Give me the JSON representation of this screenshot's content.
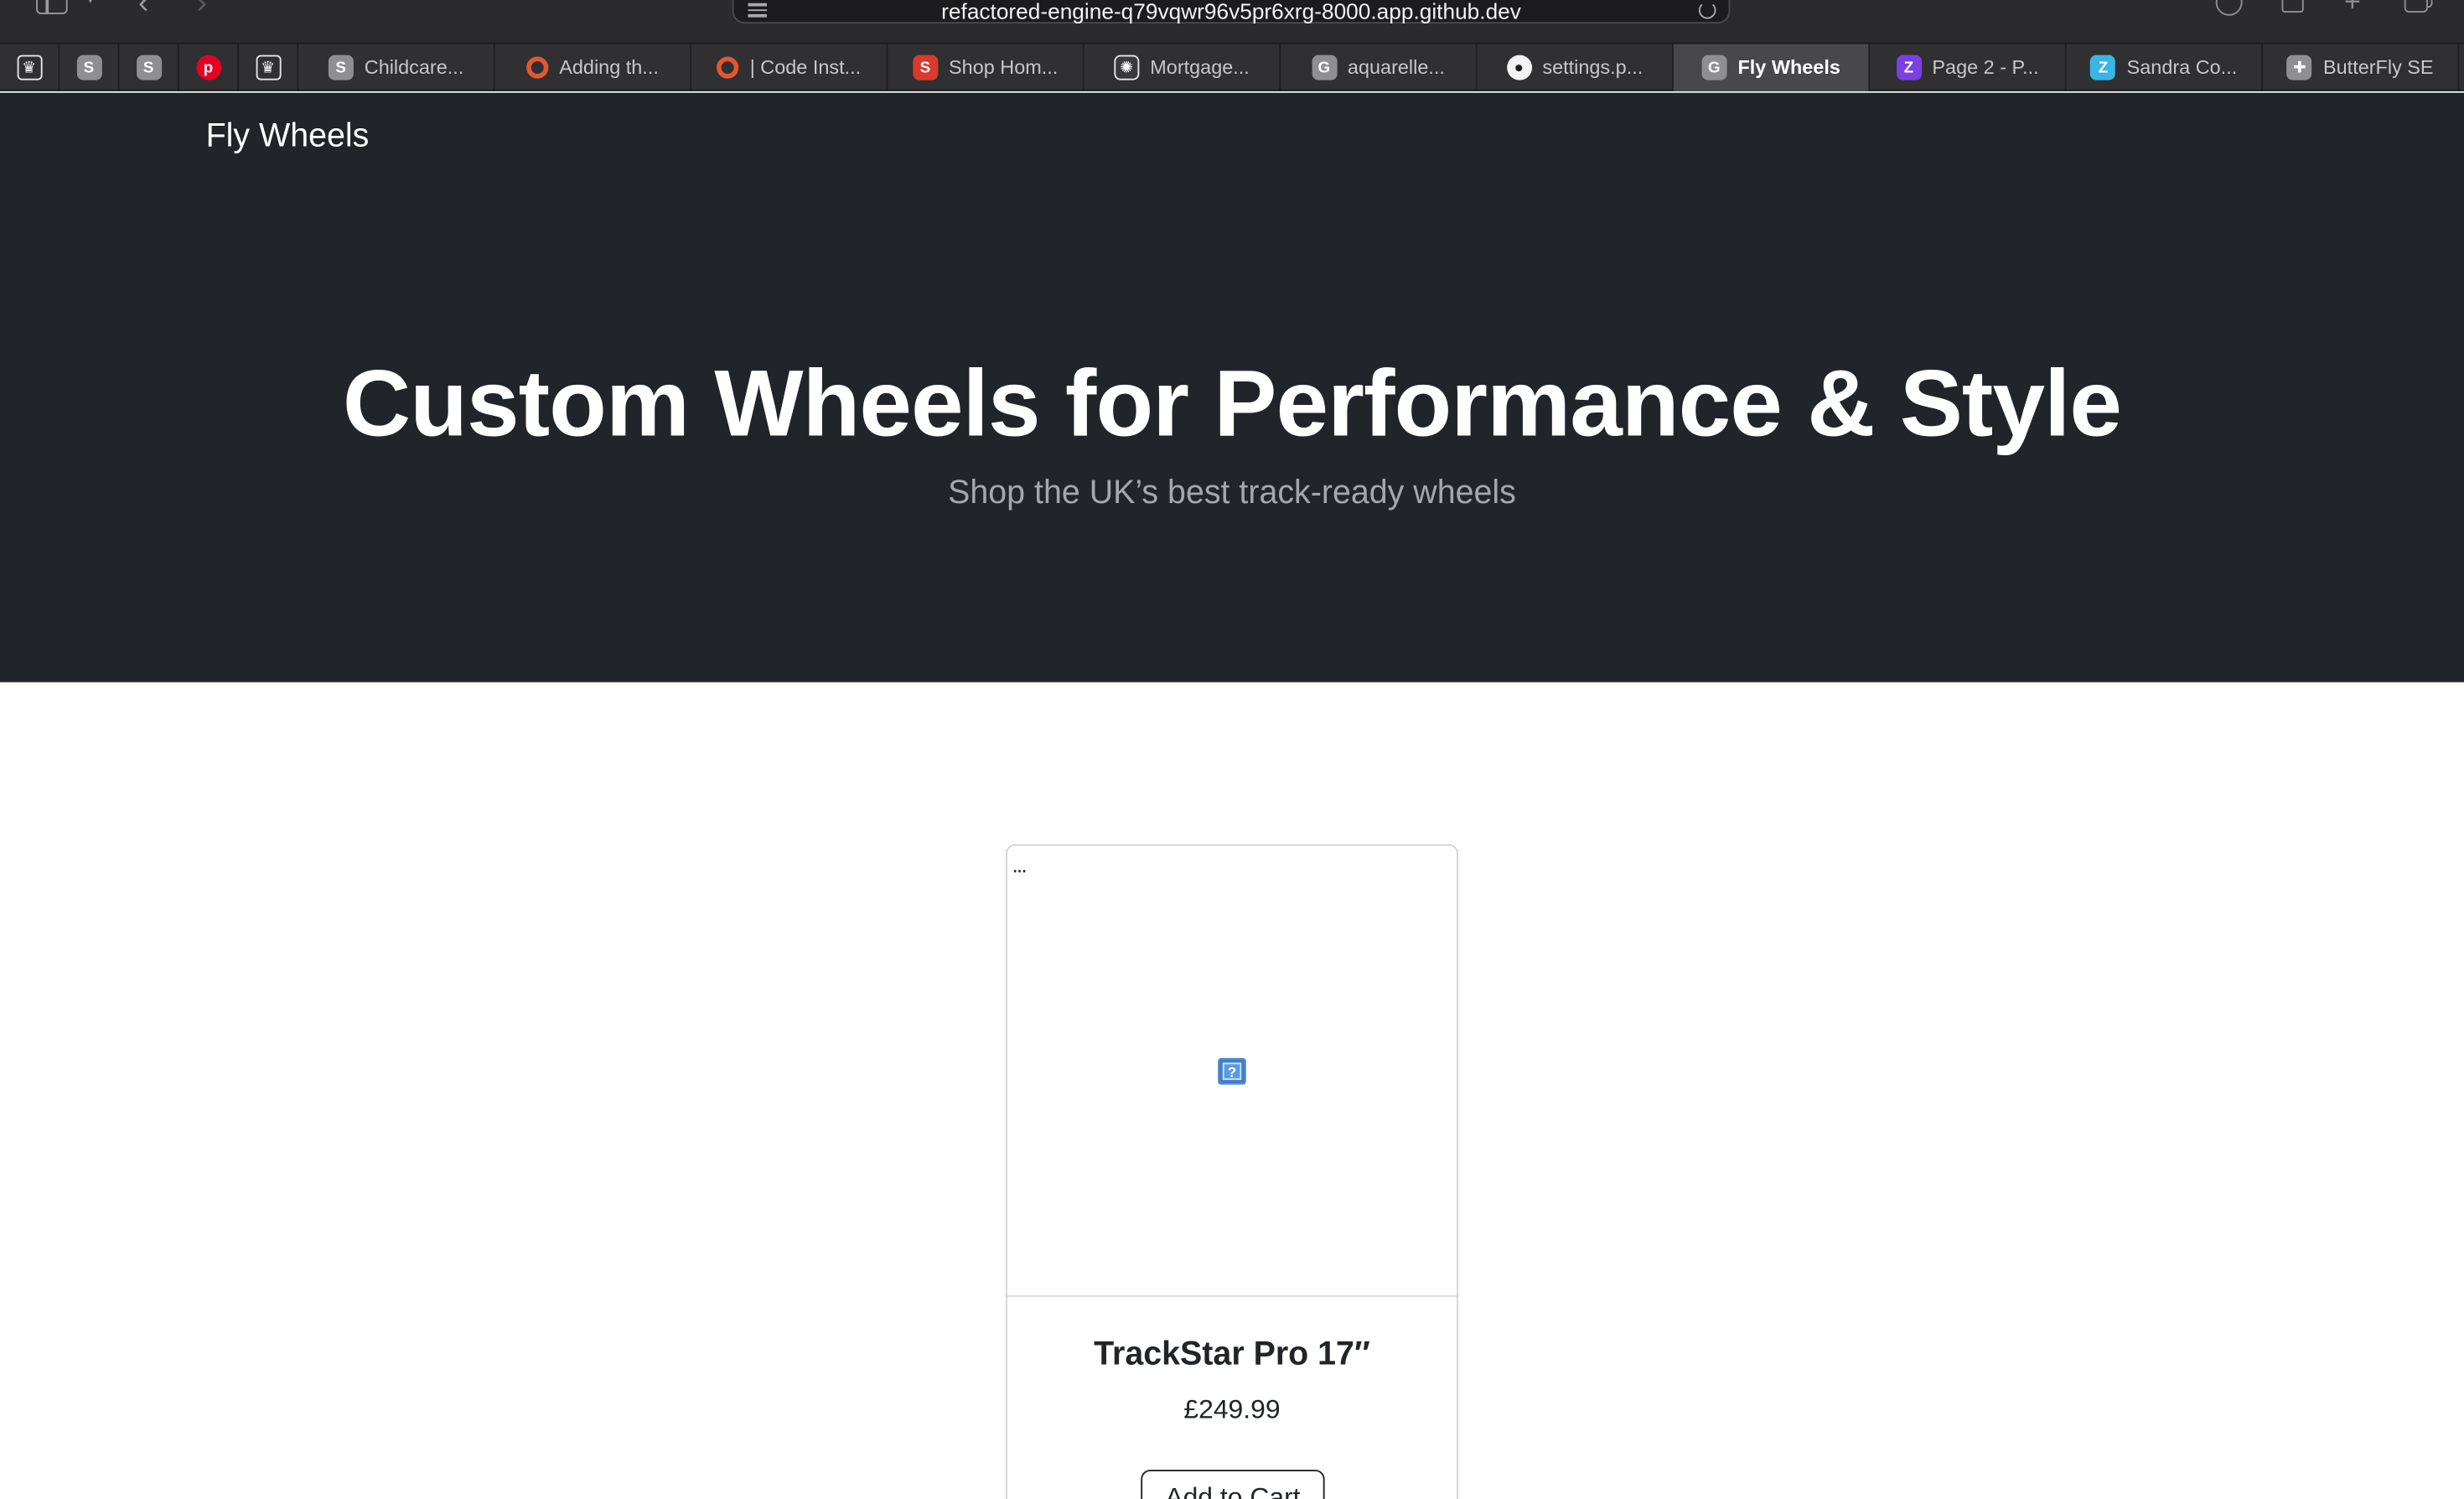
{
  "browser": {
    "url": "refactored-engine-q79vqwr96v5pr6xrg-8000.app.github.dev",
    "tabs": [
      {
        "label": "",
        "icon": "crown-icon",
        "glyph": "♛",
        "color": "#2b2b2d",
        "pinned": true
      },
      {
        "label": "",
        "icon": "s-letter-icon",
        "glyph": "S",
        "color": "#8e8e93",
        "pinned": true
      },
      {
        "label": "",
        "icon": "s-letter-icon",
        "glyph": "S",
        "color": "#8e8e93",
        "pinned": true
      },
      {
        "label": "",
        "icon": "pinterest-icon",
        "glyph": "p",
        "color": "#e60023",
        "pinned": true
      },
      {
        "label": "",
        "icon": "crown-icon",
        "glyph": "♛",
        "color": "#2b2b2d",
        "pinned": true
      },
      {
        "label": "Childcare...",
        "icon": "s-letter-icon",
        "glyph": "S",
        "color": "#8e8e93"
      },
      {
        "label": "Adding th...",
        "icon": "ring-icon",
        "glyph": "",
        "color": "#e4572e"
      },
      {
        "label": "| Code Inst...",
        "icon": "ring-icon",
        "glyph": "",
        "color": "#e4572e"
      },
      {
        "label": "Shop Hom...",
        "icon": "s-letter-icon",
        "glyph": "S",
        "color": "#d93a2b"
      },
      {
        "label": "Mortgage...",
        "icon": "openai-icon",
        "glyph": "✺",
        "color": "#3a3a3c"
      },
      {
        "label": "aquarelle...",
        "icon": "g-letter-icon",
        "glyph": "G",
        "color": "#8e8e93"
      },
      {
        "label": "settings.p...",
        "icon": "github-icon",
        "glyph": "●",
        "color": "#f2f2f2"
      },
      {
        "label": "Fly Wheels",
        "icon": "g-letter-icon",
        "glyph": "G",
        "color": "#8e8e93",
        "active": true
      },
      {
        "label": "Page 2 - P...",
        "icon": "z-letter-icon",
        "glyph": "Z",
        "color": "#7b3fe4"
      },
      {
        "label": "Sandra Co...",
        "icon": "zapier-icon",
        "glyph": "Z",
        "color": "#39b6e6"
      },
      {
        "label": "ButterFly SE",
        "icon": "butterfly-icon",
        "glyph": "✚",
        "color": "#8e8e93"
      }
    ]
  },
  "nav": {
    "brand": "Fly Wheels"
  },
  "hero": {
    "title": "Custom Wheels for Performance & Style",
    "subtitle": "Shop the UK’s best track-ready wheels"
  },
  "products": [
    {
      "image_alt": "...",
      "name": "TrackStar Pro 17″",
      "price": "£249.99",
      "button": "Add to Cart"
    }
  ],
  "colors": {
    "hero_bg": "#212529",
    "subtitle": "#a4a8ad",
    "toolbar_bg": "#2b2b2d"
  }
}
